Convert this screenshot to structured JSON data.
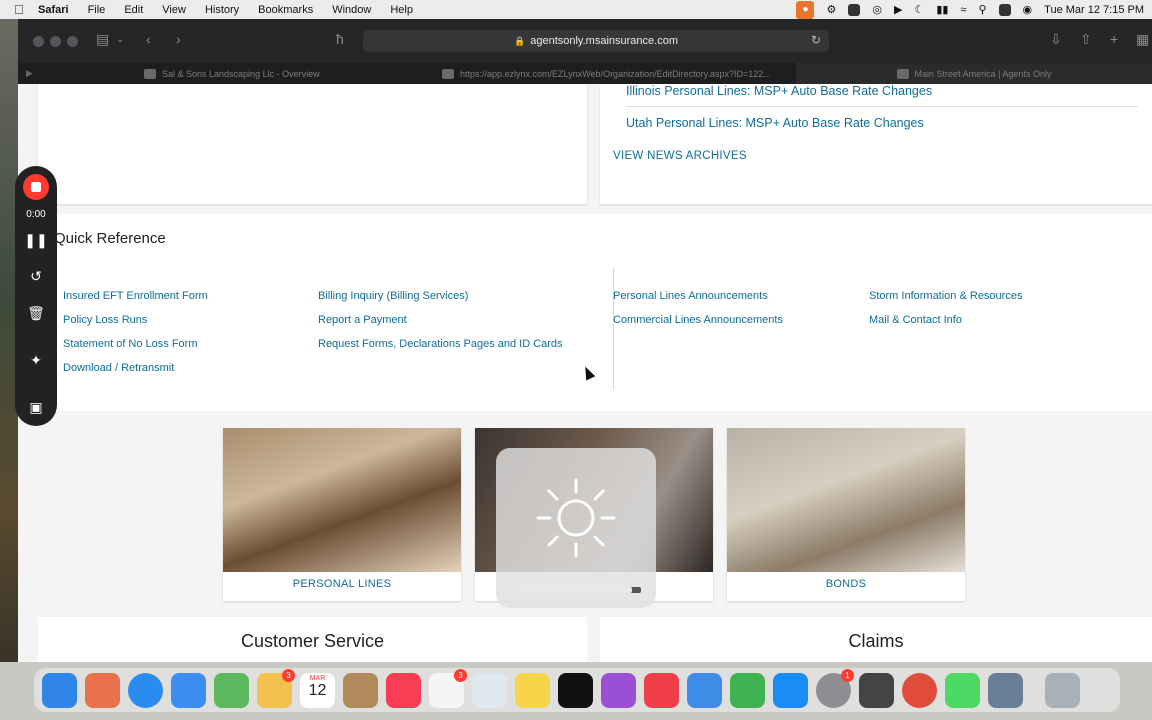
{
  "menubar": {
    "app": "Safari",
    "items": [
      "File",
      "Edit",
      "View",
      "History",
      "Bookmarks",
      "Window",
      "Help"
    ],
    "clock": "Tue Mar 12  7:15 PM"
  },
  "browser": {
    "url": "agentsonly.msainsurance.com",
    "tabs": [
      {
        "title": "Sal & Sons Landscaping Llc - Overview"
      },
      {
        "title": "https://app.ezlynx.com/EZLynxWeb/Organization/EditDirectory.aspx?ID=122..."
      },
      {
        "title": "Main Street America | Agents Only"
      }
    ]
  },
  "news": {
    "items": [
      "Illinois Personal Lines: MSP+ Auto Base Rate Changes",
      "Utah Personal Lines: MSP+ Auto Base Rate Changes"
    ],
    "archive_label": "VIEW NEWS ARCHIVES"
  },
  "quick_reference": {
    "title": "Quick Reference",
    "col1": [
      "Insured EFT Enrollment Form",
      "Policy Loss Runs",
      "Statement of No Loss Form",
      "Download / Retransmit"
    ],
    "col2": [
      "Billing Inquiry (Billing Services)",
      "Report a Payment",
      "Request Forms, Declarations Pages and ID Cards"
    ],
    "col3": [
      "Personal Lines Announcements",
      "Commercial Lines Announcements"
    ],
    "col4": [
      "Storm Information & Resources",
      "Mail & Contact Info"
    ]
  },
  "tiles": [
    {
      "label": "PERSONAL LINES"
    },
    {
      "label": ""
    },
    {
      "label": "BONDS"
    }
  ],
  "sections": {
    "customer_service": "Customer Service",
    "claims": "Claims"
  },
  "recorder": {
    "time": "0:00"
  },
  "brightness": {
    "level": 0.93
  },
  "dock": {
    "calendar_month": "MAR",
    "calendar_day": "12",
    "badges": {
      "photos": "3",
      "reminders": "3",
      "settings": "1"
    }
  }
}
